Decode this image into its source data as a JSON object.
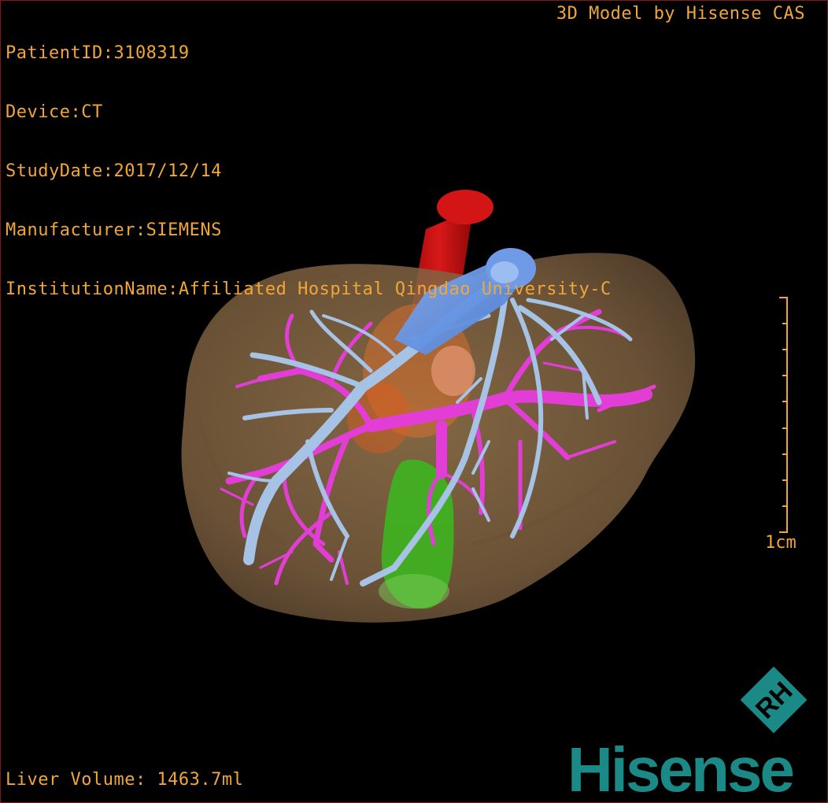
{
  "patient_info": {
    "patient_id": "PatientID:3108319",
    "device": "Device:CT",
    "study_date": "StudyDate:2017/12/14",
    "manufacturer": "Manufacturer:SIEMENS",
    "institution": "InstitutionName:Affiliated Hospital Qingdao University-C"
  },
  "model_credit": "3D Model by Hisense CAS",
  "scale_bar": {
    "label": "1cm",
    "color": "#f0a63a"
  },
  "liver_volume": "Liver Volume: 1463.7ml",
  "brand": {
    "wordmark": "Hisense",
    "logo_letters": "RH",
    "color": "#1b8a87"
  },
  "colors": {
    "overlay_text": "#f0a63a",
    "liver": "#8a6b45",
    "portal_vein": "#e23ed6",
    "hepatic_vein": "#a6c3e6",
    "ivc": "#5b8fe0",
    "aorta": "#c81010",
    "gallbladder": "#3db51f",
    "tumor": "#e8702a"
  }
}
